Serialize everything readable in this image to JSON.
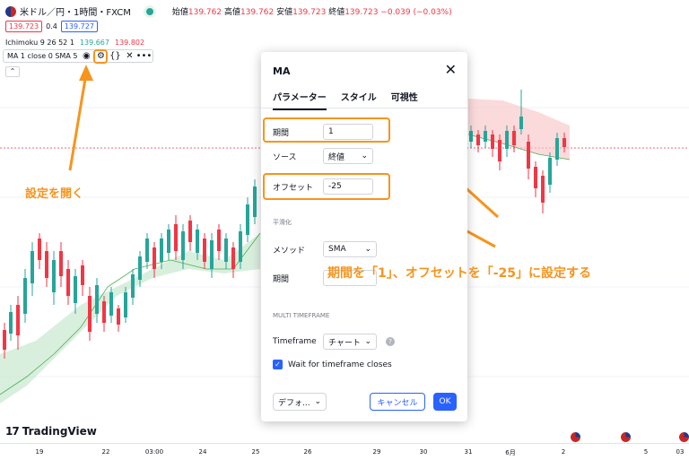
{
  "header": {
    "symbol_title": "米ドル／円・1時間・FXCM",
    "ohlc": [
      {
        "label": "始値",
        "value": "139.762"
      },
      {
        "label": "高値",
        "value": "139.762"
      },
      {
        "label": "安値",
        "value": "139.723"
      },
      {
        "label": "終値",
        "value": "139.723"
      }
    ],
    "change": "−0.039 (−0.03%)",
    "sell_price": "139.723",
    "spread": "0.4",
    "buy_price": "139.727",
    "ichimoku_label": "Ichimoku 9 26 52 1",
    "ichimoku_v1": "139.667",
    "ichimoku_v2": "139.802",
    "ma_label": "MA 1 close 0 SMA 5",
    "collapse_icon": "chevron-up-icon"
  },
  "dialog": {
    "title": "MA",
    "tabs": [
      "パラメーター",
      "スタイル",
      "可視性"
    ],
    "period_label": "期間",
    "period_value": "1",
    "source_label": "ソース",
    "source_value": "終値",
    "offset_label": "オフセット",
    "offset_value": "-25",
    "smoothing_section": "平滑化",
    "method_label": "メソッド",
    "method_value": "SMA",
    "smooth_period_label": "期間",
    "multi_tf_section": "MULTI TIMEFRAME",
    "timeframe_label": "Timeframe",
    "timeframe_value": "チャート",
    "wait_label": "Wait for timeframe closes",
    "defaults_label": "デフォ...",
    "cancel_label": "キャンセル",
    "ok_label": "OK"
  },
  "annotations": {
    "open_settings": "設定を開く",
    "instruction": "期間を「1」、オフセットを「-25」に設定する"
  },
  "branding": {
    "logo_text": "TradingView"
  },
  "xaxis": {
    "ticks": [
      "19",
      "22",
      "03:00",
      "24",
      "25",
      "26",
      "29",
      "30",
      "31",
      "6月",
      "2",
      "5",
      "03"
    ]
  },
  "colors": {
    "accent": "#2962ff",
    "highlight": "#f7941d",
    "down": "#f23645",
    "up": "#26a69a"
  }
}
